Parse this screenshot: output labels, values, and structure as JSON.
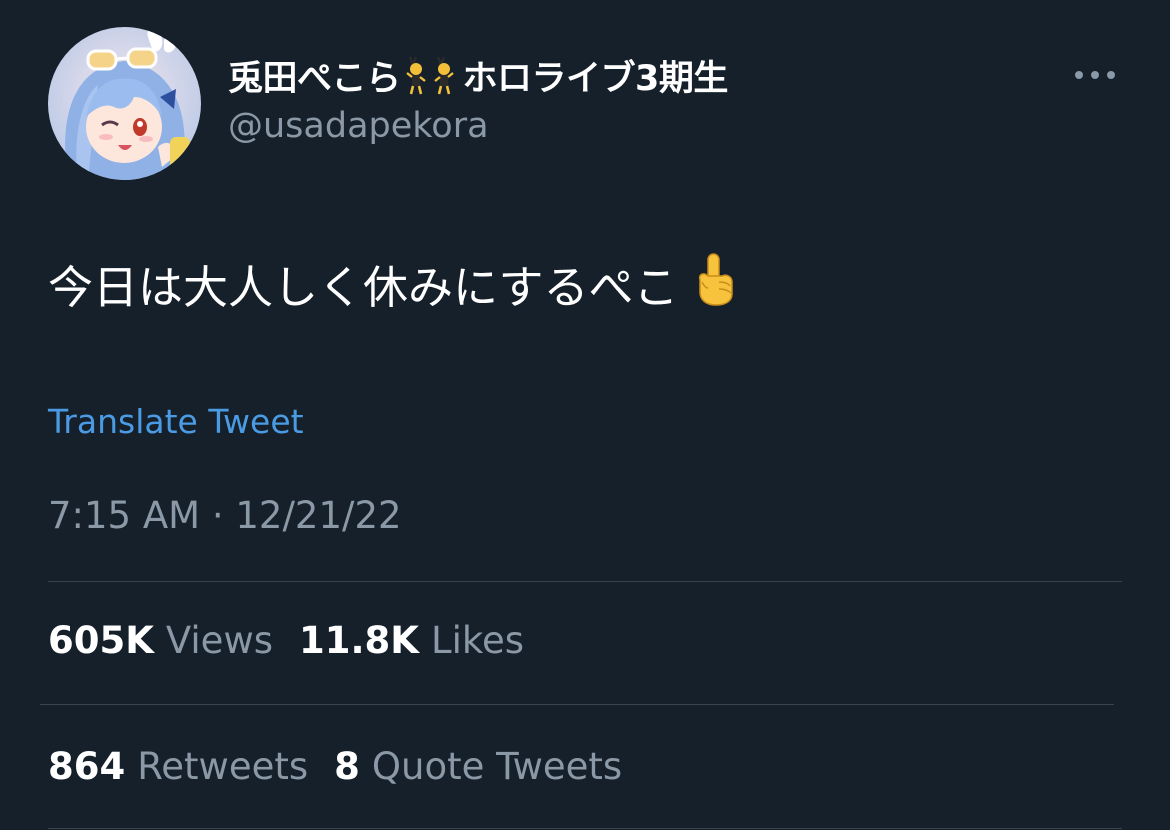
{
  "author": {
    "display_name_prefix": "兎田ぺこら",
    "display_name_suffix": "ホロライブ3期生",
    "name_emoji": "dancing-bunny-girls-icon",
    "handle": "@usadapekora",
    "avatar": "avatar-anime-bunny-girl-image"
  },
  "more_icon": "more-dots-icon",
  "tweet": {
    "text": "今日は大人しく休みにするぺこ",
    "emoji": "pointing-up-hand-icon",
    "translate_label": "Translate Tweet",
    "timestamp": "7:15 AM · 12/21/22"
  },
  "stats": {
    "views": {
      "count": "605K",
      "label": "Views"
    },
    "likes": {
      "count": "11.8K",
      "label": "Likes"
    },
    "retweets": {
      "count": "864",
      "label": "Retweets"
    },
    "quotes": {
      "count": "8",
      "label": "Quote Tweets"
    }
  },
  "colors": {
    "background": "#15202b",
    "text_primary": "#ffffff",
    "text_secondary": "#8b98a5",
    "link": "#4a9be3",
    "divider": "#38444d"
  }
}
